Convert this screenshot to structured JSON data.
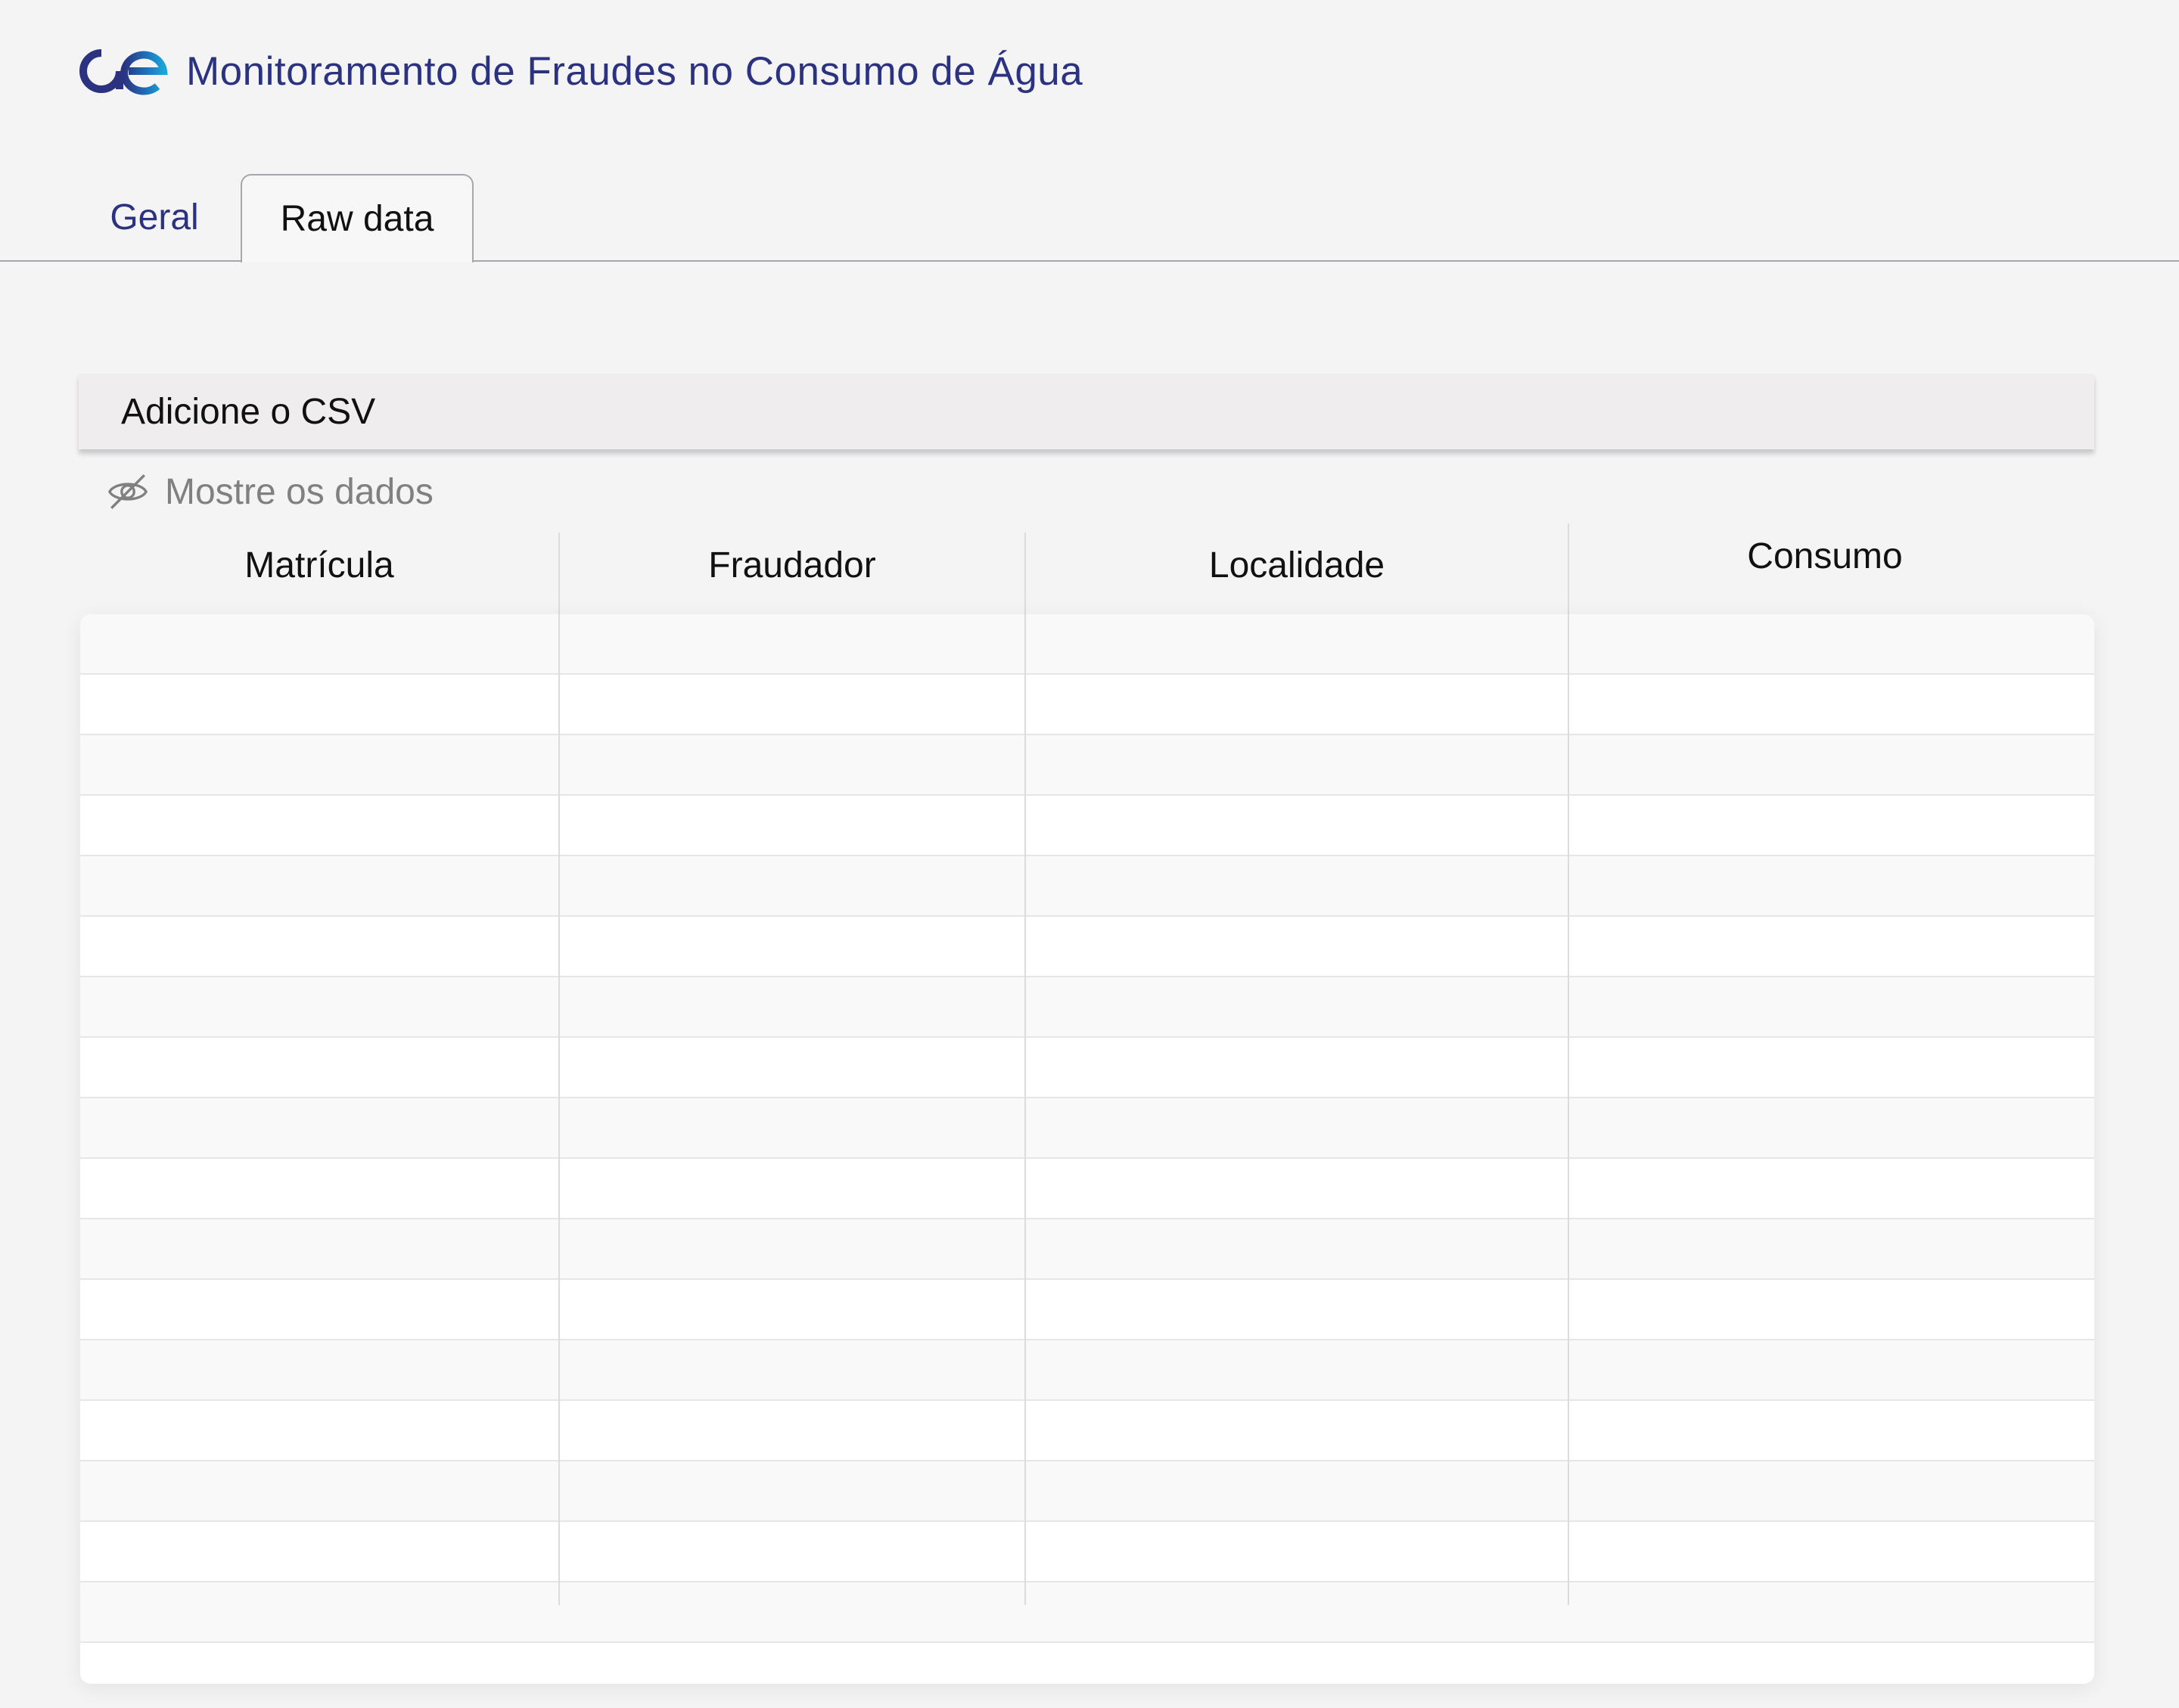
{
  "app": {
    "title": "Monitoramento de Fraudes no Consumo de Água"
  },
  "tabs": [
    {
      "label": "Geral",
      "active": false
    },
    {
      "label": "Raw data",
      "active": true
    }
  ],
  "upload": {
    "label": "Adicione o CSV"
  },
  "toggle": {
    "label": "Mostre os dados",
    "icon": "eye-off-icon"
  },
  "table": {
    "columns": [
      "Matrícula",
      "Fraudador",
      "Localidade",
      "Consumo"
    ],
    "rows": []
  },
  "colors": {
    "brand": "#2b3380",
    "accent": "#1ba4d8",
    "background": "#f4f4f5"
  }
}
